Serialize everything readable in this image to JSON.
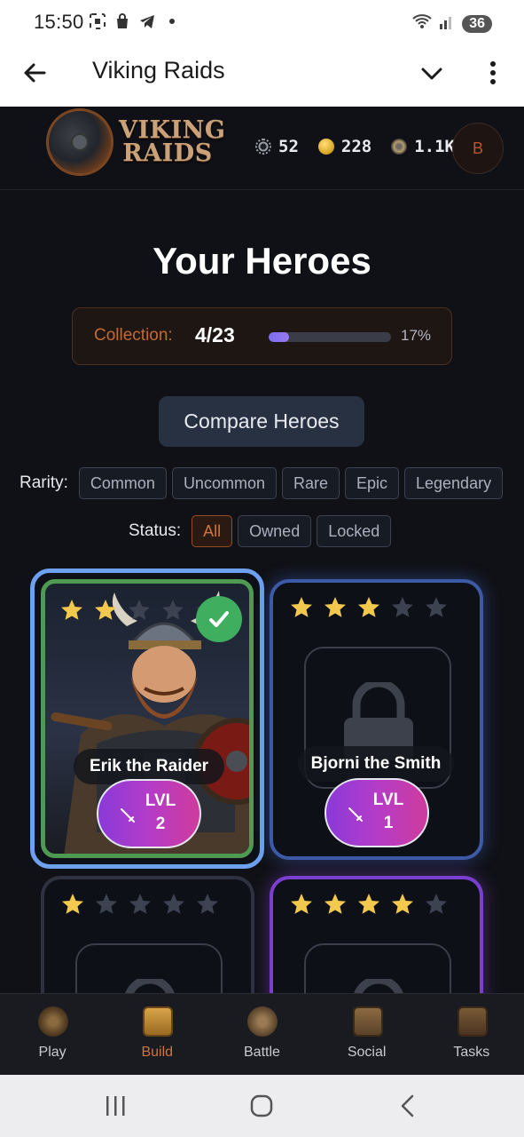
{
  "status_bar": {
    "time": "15:50",
    "battery": "36"
  },
  "app_bar": {
    "title": "Viking Raids"
  },
  "game": {
    "logo": {
      "line1": "VIKING",
      "line2": "RAIDS"
    },
    "resources": [
      {
        "icon": "gear-token-icon",
        "value": "52"
      },
      {
        "icon": "gold-coin-icon",
        "value": "228"
      },
      {
        "icon": "shield-token-icon",
        "value": "1.1K"
      }
    ],
    "avatar_initial": "B",
    "page_title": "Your Heroes",
    "collection": {
      "label": "Collection:",
      "count": "4/23",
      "progress_fraction": 0.17,
      "percent": "17%"
    },
    "compare_button": "Compare Heroes",
    "rarity": {
      "label": "Rarity:",
      "options": [
        "Common",
        "Uncommon",
        "Rare",
        "Epic",
        "Legendary"
      ]
    },
    "status": {
      "label": "Status:",
      "options": [
        "All",
        "Owned",
        "Locked"
      ],
      "selected": "All"
    },
    "heroes": [
      {
        "name": "Erik the Raider",
        "stars": 2,
        "max_stars": 5,
        "level_label": "LVL",
        "level": "2",
        "owned": true,
        "selected": true
      },
      {
        "name": "Bjorni the Smith",
        "stars": 3,
        "max_stars": 5,
        "level_label": "LVL",
        "level": "1",
        "owned": false,
        "selected": false
      },
      {
        "stars": 1,
        "max_stars": 5,
        "owned": false
      },
      {
        "stars": 4,
        "max_stars": 5,
        "owned": false
      }
    ],
    "nav": [
      {
        "label": "Play",
        "icon": "play-shield-icon",
        "active": false
      },
      {
        "label": "Build",
        "icon": "build-hammer-icon",
        "active": true
      },
      {
        "label": "Battle",
        "icon": "battle-swords-icon",
        "active": false
      },
      {
        "label": "Social",
        "icon": "social-crest-icon",
        "active": false
      },
      {
        "label": "Tasks",
        "icon": "tasks-scroll-icon",
        "active": false
      }
    ]
  },
  "colors": {
    "accent": "#d0733e",
    "star_gold": "#f2c94c",
    "star_empty": "#3d4250",
    "owned_border": "#4f9a52",
    "selected_border": "#6ea0f0"
  }
}
